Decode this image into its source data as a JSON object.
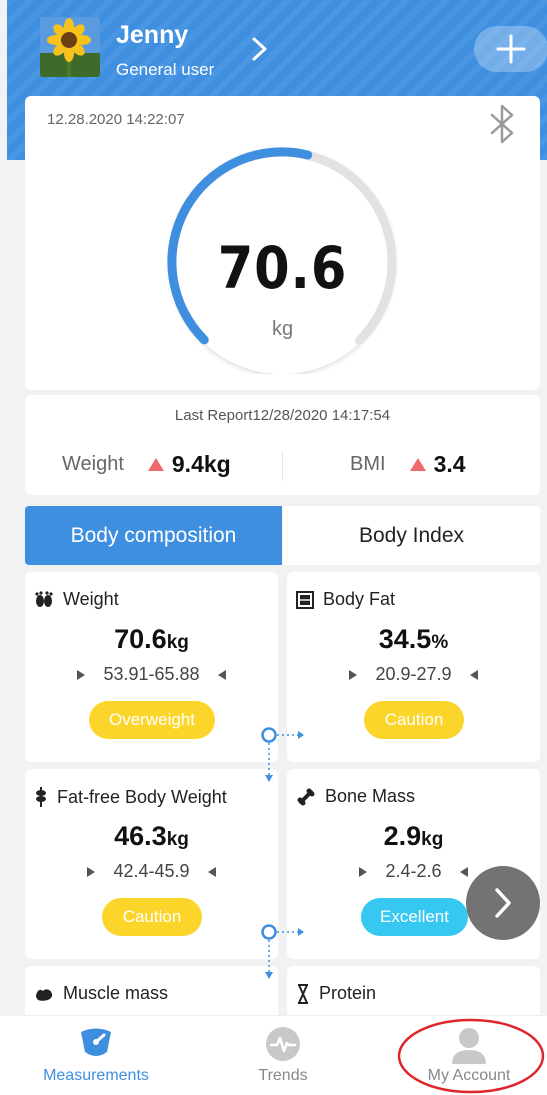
{
  "header": {
    "user_name": "Jenny",
    "user_role": "General user",
    "accent_color": "#3f8fe0",
    "icons": [
      "avatar-sunflower",
      "chevron-right-icon",
      "plus-icon"
    ]
  },
  "measurement": {
    "datetime": "12.28.2020 14:22:07",
    "weight_value": "70.6",
    "weight_unit": "kg",
    "gauge_fill_fraction": 0.55
  },
  "report": {
    "last_report": "Last Report12/28/2020 14:17:54",
    "weight_label": "Weight",
    "weight_delta": "9.4kg",
    "bmi_label": "BMI",
    "bmi_delta": "3.4",
    "delta_color": "#f0686a"
  },
  "tabs": {
    "active": "Body composition",
    "inactive": "Body Index"
  },
  "metrics": [
    {
      "name": "Weight",
      "value": "70.6",
      "unit": "kg",
      "range": "53.91-65.88",
      "status": "Overweight"
    },
    {
      "name": "Body Fat",
      "value": "34.5",
      "unit": "%",
      "range": "20.9-27.9",
      "status": "Caution"
    },
    {
      "name": "Fat-free Body Weight",
      "value": "46.3",
      "unit": "kg",
      "range": "42.4-45.9",
      "status": "Caution"
    },
    {
      "name": "Bone Mass",
      "value": "2.9",
      "unit": "kg",
      "range": "2.4-2.6",
      "status": "Excellent"
    },
    {
      "name": "Muscle mass"
    },
    {
      "name": "Protein"
    }
  ],
  "status_colors": {
    "yellow": "#fcd52b",
    "cyan": "#37c8f2"
  },
  "nav": {
    "measurements": "Measurements",
    "trends": "Trends",
    "my_account": "My Account"
  }
}
